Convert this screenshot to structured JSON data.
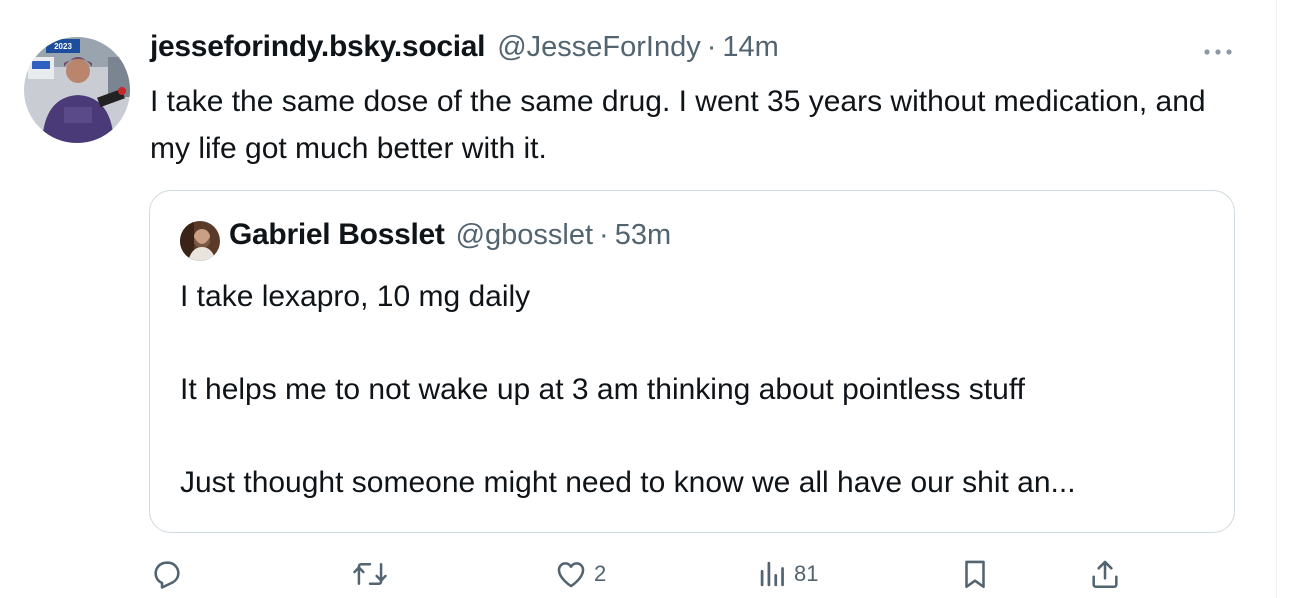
{
  "post": {
    "display_name": "jesseforindy.bsky.social",
    "handle": "@JesseForIndy",
    "separator": "·",
    "time": "14m",
    "text": "I take the same dose of the same drug. I went 35 years without medication, and my life got much better with it.",
    "avatar_sign_text": "2023"
  },
  "quote": {
    "display_name": "Gabriel Bosslet",
    "handle": "@gbosslet",
    "separator": "·",
    "time": "53m",
    "lines": [
      "I take lexapro, 10 mg daily",
      "It helps me to not wake up at 3 am thinking about pointless stuff",
      "Just thought someone might need to know we all have our shit an..."
    ]
  },
  "actions": {
    "reply_count": "",
    "retweet_count": "",
    "like_count": "2",
    "views_count": "81"
  },
  "colors": {
    "text": "#0f1419",
    "secondary": "#536471",
    "border": "#cfd9de"
  },
  "icons": [
    "more-icon",
    "reply-icon",
    "retweet-icon",
    "like-icon",
    "views-icon",
    "bookmark-icon",
    "share-icon"
  ]
}
